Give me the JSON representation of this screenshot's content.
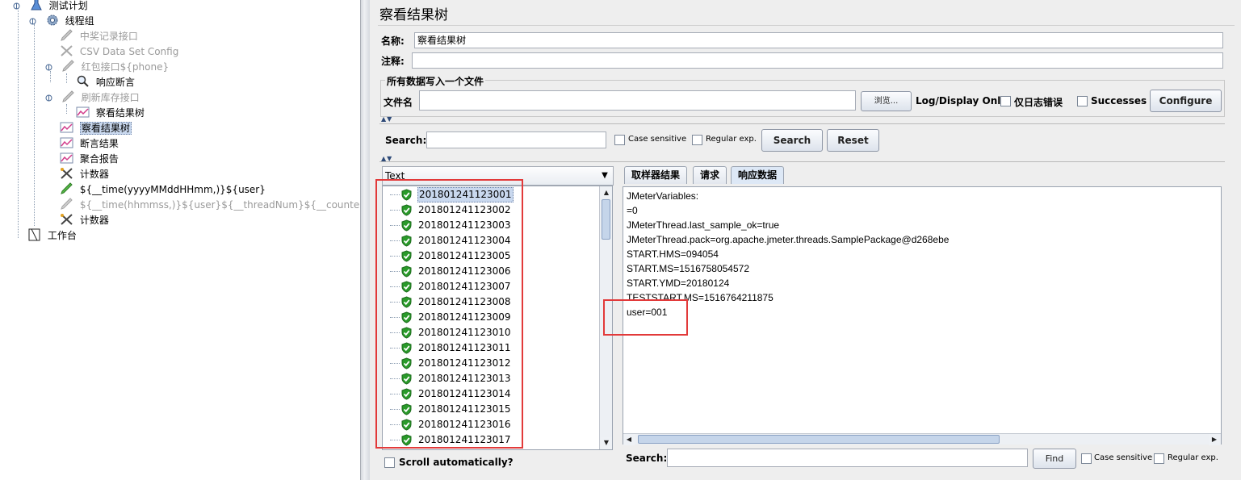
{
  "tree": {
    "items": [
      {
        "label": "测试计划",
        "icon": "flask-icon",
        "disabled": false
      },
      {
        "label": "线程组",
        "icon": "gear-icon",
        "disabled": false
      },
      {
        "label": "中奖记录接口",
        "icon": "pencil-icon",
        "disabled": true
      },
      {
        "label": "CSV Data Set Config",
        "icon": "wrench-scissors-icon",
        "disabled": true
      },
      {
        "label": "红包接口${phone}",
        "icon": "pencil-icon",
        "disabled": true
      },
      {
        "label": "响应断言",
        "icon": "magnifier-icon",
        "disabled": false
      },
      {
        "label": "刷新库存接口",
        "icon": "pencil-icon",
        "disabled": true
      },
      {
        "label": "察看结果树",
        "icon": "chart-icon",
        "disabled": false
      },
      {
        "label": "察看结果树",
        "icon": "chart-icon",
        "disabled": false
      },
      {
        "label": "断言结果",
        "icon": "chart-icon",
        "disabled": false
      },
      {
        "label": "聚合报告",
        "icon": "chart-icon",
        "disabled": false
      },
      {
        "label": "计数器",
        "icon": "wrench-scissors-icon",
        "disabled": false
      },
      {
        "label": "${__time(yyyyMMddHHmm,)}${user}",
        "icon": "pen-icon",
        "disabled": false
      },
      {
        "label": "${__time(hhmmss,)}${user}${__threadNum}${__counter(,)}",
        "icon": "pen-icon",
        "disabled": true
      },
      {
        "label": "计数器",
        "icon": "wrench-scissors-icon",
        "disabled": false
      },
      {
        "label": "工作台",
        "icon": "notebook-icon",
        "disabled": false
      }
    ]
  },
  "panel": {
    "title": "察看结果树",
    "name_label": "名称:",
    "name_value": "察看结果树",
    "comment_label": "注释:",
    "comment_value": "",
    "file_group_title": "所有数据写入一个文件",
    "filename_label": "文件名",
    "filename_value": "",
    "browse_label": "浏览...",
    "log_display_label": "Log/Display Only:",
    "errors_only_label": "仅日志错误",
    "successes_label": "Successes",
    "configure_label": "Configure"
  },
  "search": {
    "label": "Search:",
    "value": "",
    "case_sensitive": "Case sensitive",
    "regular_exp": "Regular exp.",
    "search_btn": "Search",
    "reset_btn": "Reset"
  },
  "renderer": {
    "selected": "Text"
  },
  "results": [
    "201801241123001",
    "201801241123002",
    "201801241123003",
    "201801241123004",
    "201801241123005",
    "201801241123006",
    "201801241123007",
    "201801241123008",
    "201801241123009",
    "201801241123010",
    "201801241123011",
    "201801241123012",
    "201801241123013",
    "201801241123014",
    "201801241123015",
    "201801241123016",
    "201801241123017"
  ],
  "scroll_auto_label": "Scroll automatically?",
  "tabs": [
    "取样器结果",
    "请求",
    "响应数据"
  ],
  "active_tab": "响应数据",
  "response_lines": [
    "JMeterVariables:",
    "=0",
    "JMeterThread.last_sample_ok=true",
    "JMeterThread.pack=org.apache.jmeter.threads.SamplePackage@d268ebe",
    "START.HMS=094054",
    "START.MS=1516758054572",
    "START.YMD=20180124",
    "TESTSTART.MS=1516764211875",
    "user=001"
  ],
  "bottom_search": {
    "label": "Search:",
    "value": "",
    "find_btn": "Find",
    "case_sensitive": "Case sensitive",
    "regular_exp": "Regular exp."
  },
  "colors": {
    "highlight_box": "#e23a3a",
    "selection": "#c9d8ee",
    "success_shield": "#2a9a2a"
  }
}
